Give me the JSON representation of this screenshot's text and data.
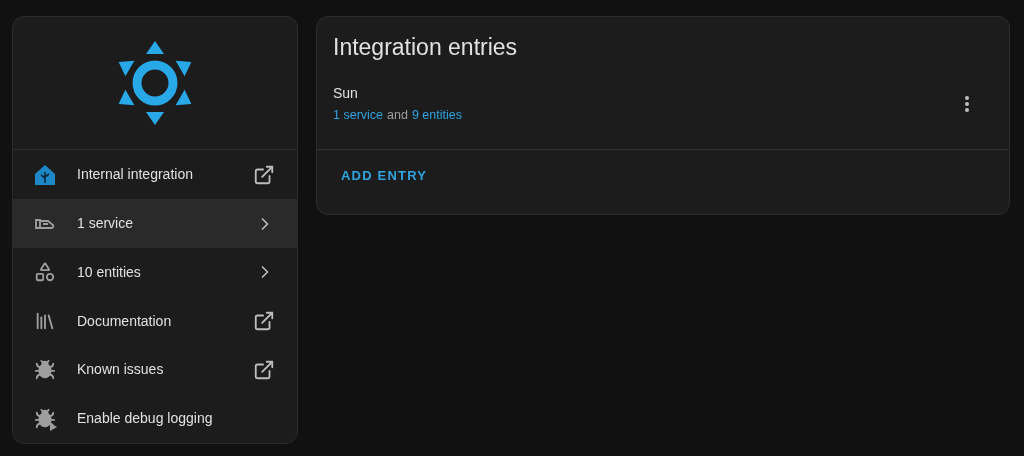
{
  "sidebar": {
    "items": [
      {
        "kind": "link",
        "label": "Internal integration",
        "selected": false
      },
      {
        "kind": "submenu",
        "label": "1 service",
        "selected": true
      },
      {
        "kind": "submenu",
        "label": "10 entities",
        "selected": false
      },
      {
        "kind": "link",
        "label": "Documentation",
        "selected": false
      },
      {
        "kind": "link",
        "label": "Known issues",
        "selected": false
      },
      {
        "kind": "action",
        "label": "Enable debug logging",
        "selected": false
      }
    ]
  },
  "entries": {
    "title": "Integration entries",
    "items": [
      {
        "name": "Sun",
        "summary": [
          {
            "kind": "link",
            "text": "1 service"
          },
          {
            "kind": "text",
            "text": "and"
          },
          {
            "kind": "link",
            "text": "9 entities"
          }
        ]
      }
    ],
    "add_button": "ADD ENTRY"
  }
}
